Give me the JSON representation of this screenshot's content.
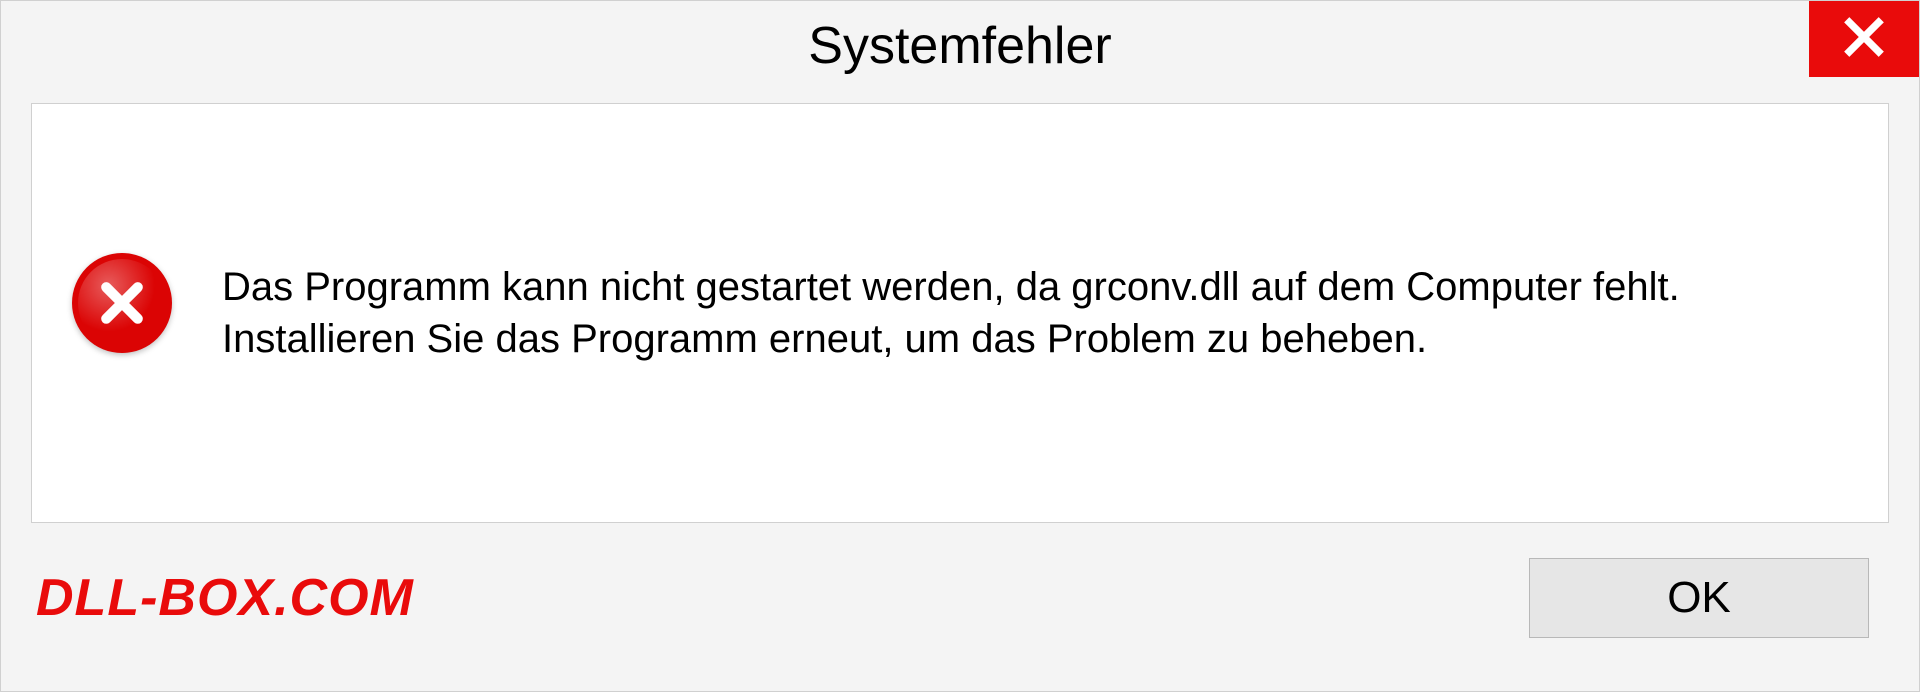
{
  "dialog": {
    "title": "Systemfehler",
    "message": "Das Programm kann nicht gestartet werden, da grconv.dll auf dem Computer fehlt. Installieren Sie das Programm erneut, um das Problem zu beheben.",
    "ok_label": "OK"
  },
  "branding": "DLL-BOX.COM"
}
